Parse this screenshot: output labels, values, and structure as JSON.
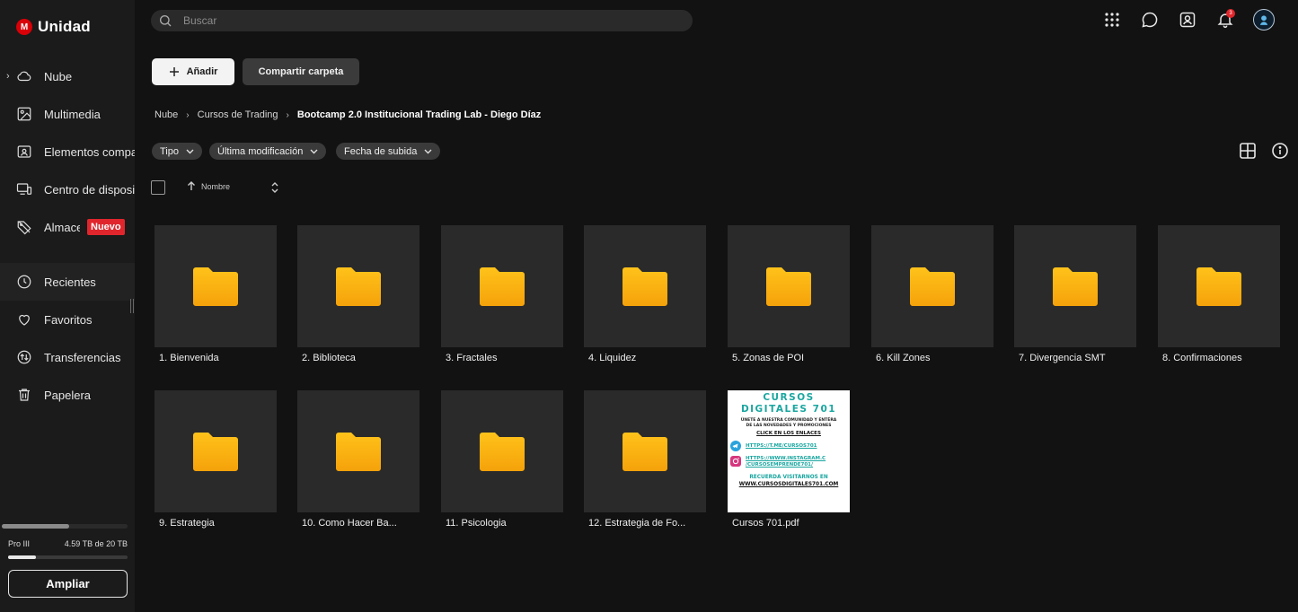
{
  "app": {
    "logo_letter": "M",
    "title": "Unidad",
    "brand_color": "#d90007"
  },
  "sidebar": {
    "items": [
      {
        "label": "Nube",
        "icon": "cloud-icon"
      },
      {
        "label": "Multimedia",
        "icon": "image-icon"
      },
      {
        "label": "Elementos compartidos",
        "icon": "shared-folder-icon"
      },
      {
        "label": "Centro de dispositivos",
        "icon": "devices-icon"
      },
      {
        "label": "Almacenamiento",
        "icon": "tag-icon",
        "badge": "Nuevo"
      },
      {
        "label": "Recientes",
        "icon": "clock-icon"
      },
      {
        "label": "Favoritos",
        "icon": "heart-icon"
      },
      {
        "label": "Transferencias",
        "icon": "transfer-icon"
      },
      {
        "label": "Papelera",
        "icon": "trash-icon"
      }
    ],
    "plan": "Pro III",
    "storage_used": "4.59 TB de 20 TB",
    "storage_fraction": 0.23,
    "upgrade_label": "Ampliar"
  },
  "search": {
    "placeholder": "Buscar"
  },
  "header": {
    "notification_count": "3"
  },
  "toolbar": {
    "add_label": "Añadir",
    "share_label": "Compartir carpeta"
  },
  "breadcrumb": [
    "Nube",
    "Cursos de Trading",
    "Bootcamp 2.0 Institucional Trading Lab - Diego Díaz"
  ],
  "filters": [
    "Tipo",
    "Última modificación",
    "Fecha de subida"
  ],
  "list_header": {
    "sort_label": "Nombre"
  },
  "folders": [
    "1. Bienvenida",
    "2. Biblioteca",
    "3. Fractales",
    "4. Liquidez",
    "5. Zonas de POI",
    "6. Kill Zones",
    "7. Divergencia SMT",
    "8. Confirmaciones",
    "9. Estrategia",
    "10. Como Hacer Ba...",
    "11. Psicologia",
    "12. Estrategia de Fo..."
  ],
  "file": {
    "name": "Cursos 701.pdf",
    "preview": {
      "title1": "CURSOS",
      "title2": "DIGITALES 701",
      "line1": "ÚNETE A NUESTRA COMUNIDAD Y ENTÉRA",
      "line2": "DE LAS NOVEDADES Y PROMOCIONES",
      "click": "CLICK EN LOS ENLACES",
      "link1": "HTTPS://T.ME/CURSOS701",
      "link2a": "HTTPS://WWW.INSTAGRAM.C",
      "link2b": "/CURSOSEMPRENDE701/",
      "footer1": "RECUERDA VISITARNOS EN",
      "footer2": "WWW.CURSOSDIGITALES701.COM"
    }
  }
}
